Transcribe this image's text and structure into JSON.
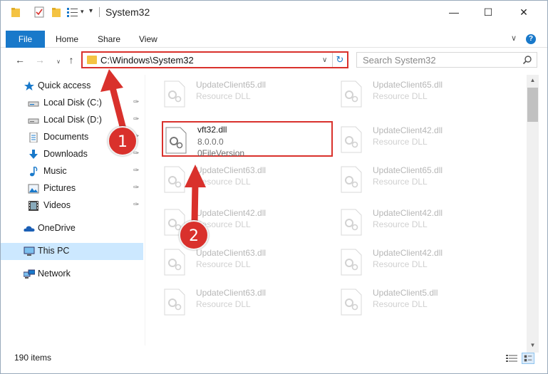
{
  "window": {
    "title": "System32",
    "controls": {
      "minimize": "—",
      "maximize": "☐",
      "close": "✕"
    }
  },
  "ribbon": {
    "tabs": {
      "file": "File",
      "home": "Home",
      "share": "Share",
      "view": "View"
    },
    "expand_glyph": "∨",
    "help_glyph": "?"
  },
  "address": {
    "path": "C:\\Windows\\System32",
    "dropdown_glyph": "∨",
    "refresh_glyph": "↻"
  },
  "search": {
    "placeholder": "Search System32",
    "icon": "search-icon"
  },
  "nav": {
    "back": "←",
    "forward": "→",
    "recent": "∨",
    "up": "↑"
  },
  "navpane": {
    "items": [
      {
        "label": "Quick access",
        "icon": "star-icon",
        "pinned": false
      },
      {
        "label": "Local Disk (C:)",
        "icon": "drive-icon",
        "pinned": true
      },
      {
        "label": "Local Disk (D:)",
        "icon": "drive-icon",
        "pinned": true
      },
      {
        "label": "Documents",
        "icon": "documents-icon",
        "pinned": true
      },
      {
        "label": "Downloads",
        "icon": "downloads-icon",
        "pinned": true
      },
      {
        "label": "Music",
        "icon": "music-icon",
        "pinned": true
      },
      {
        "label": "Pictures",
        "icon": "pictures-icon",
        "pinned": true
      },
      {
        "label": "Videos",
        "icon": "videos-icon",
        "pinned": true
      },
      {
        "label": "OneDrive",
        "icon": "onedrive-icon",
        "pinned": false
      },
      {
        "label": "This PC",
        "icon": "this-pc-icon",
        "pinned": false,
        "selected": true
      },
      {
        "label": "Network",
        "icon": "network-icon",
        "pinned": false
      }
    ],
    "pin_glyph": "📌"
  },
  "files": {
    "highlighted": {
      "name": "vft32.dll",
      "version": "8.0.0.0",
      "detail": "0FileVersion"
    },
    "left_column": [
      {
        "name": "UpdateClient65.dll",
        "type": "Resource DLL"
      },
      {
        "name": "UpdateClient63.dll",
        "type": "Resource DLL"
      },
      {
        "name": "UpdateClient42.dll",
        "type": "Resource DLL"
      },
      {
        "name": "UpdateClient63.dll",
        "type": "Resource DLL"
      },
      {
        "name": "UpdateClient63.dll",
        "type": "Resource DLL"
      }
    ],
    "right_column": [
      {
        "name": "UpdateClient65.dll",
        "type": "Resource DLL"
      },
      {
        "name": "UpdateClient42.dll",
        "type": "Resource DLL"
      },
      {
        "name": "UpdateClient65.dll",
        "type": "Resource DLL"
      },
      {
        "name": "UpdateClient42.dll",
        "type": "Resource DLL"
      },
      {
        "name": "UpdateClient42.dll",
        "type": "Resource DLL"
      },
      {
        "name": "UpdateClient5.dll",
        "type": "Resource DLL"
      }
    ]
  },
  "scrollbar": {
    "up": "▲",
    "down": "▼"
  },
  "status": {
    "item_count": "190 items"
  },
  "callouts": {
    "one": "1",
    "two": "2"
  },
  "colors": {
    "accent": "#1979ca",
    "highlight": "#d9312c",
    "selected": "#cce8ff",
    "folder": "#f4c343"
  }
}
